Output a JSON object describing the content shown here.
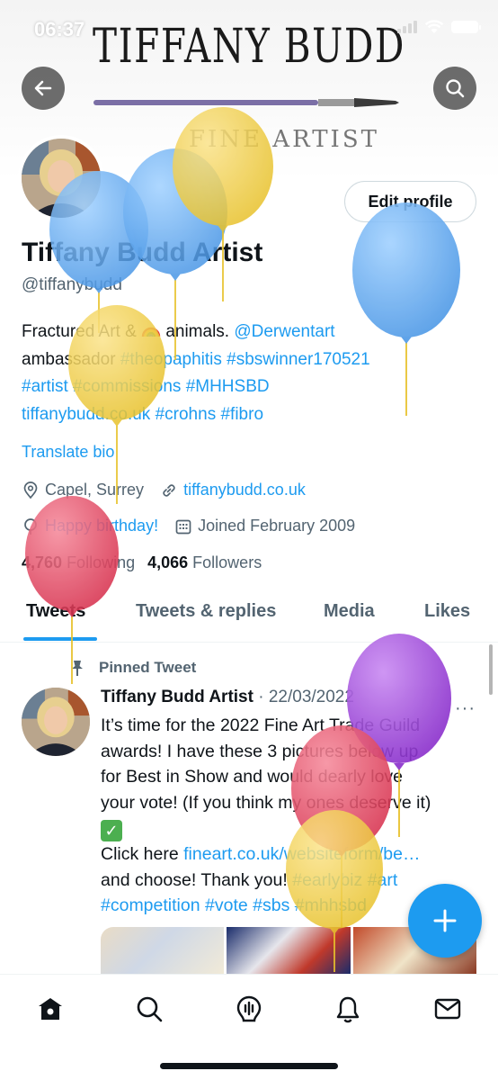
{
  "status_bar": {
    "time": "06:37"
  },
  "banner": {
    "title": "TIFFANY BUDD",
    "subtitle": "FINE ARTIST"
  },
  "header": {
    "back_icon": "arrow-left-icon",
    "search_icon": "search-icon"
  },
  "profile": {
    "edit_label": "Edit profile",
    "display_name": "Tiffany Budd Artist",
    "handle": "@tiffanybudd",
    "bio": {
      "l1_a": "Fractured Art & ",
      "l1_b": " animals. ",
      "l1_link": "@Derwentart",
      "l2_a": "ambassador ",
      "l2_link1": "#theopaphitis",
      "l2_link2": "#sbswinner170521",
      "l3_link1": "#artist",
      "l3_link2": "#commissions",
      "l3_link3": "#MHHSBD",
      "l4_link1": "tiffanybudd.co.uk",
      "l4_link2": "#crohns",
      "l4_link3": "#fibro"
    },
    "translate": "Translate bio",
    "location": "Capel, Surrey",
    "website": "tiffanybudd.co.uk",
    "birthday": "Happy birthday!",
    "joined": "Joined February 2009",
    "following_count": "4,760",
    "following_label": "Following",
    "followers_count": "4,066",
    "followers_label": "Followers"
  },
  "tabs": [
    {
      "label": "Tweets"
    },
    {
      "label": "Tweets & replies"
    },
    {
      "label": "Media"
    },
    {
      "label": "Likes"
    }
  ],
  "tweet": {
    "pinned_label": "Pinned Tweet",
    "author": "Tiffany Budd Artist",
    "date": "· 22/03/2022",
    "more": "···",
    "line1": "It’s time for the 2022 Fine Art Trade Guild",
    "line2": "awards! I have these 3 pictures below up",
    "line3": "for Best in Show and would dearly love",
    "line4": "your vote! (If you think my ones deserve it)",
    "line6_a": "Click here ",
    "line6_link": "fineart.co.uk/websiteform/be…",
    "line7_a": "and choose! Thank you! ",
    "line7_link1": "#earlybiz",
    "line7_link2": "#art",
    "line8_link1": "#competition",
    "line8_link2": "#vote",
    "line8_link3": "#sbs",
    "line8_link4": "#mhhsbd"
  },
  "nav_icons": [
    "home-icon",
    "search-icon",
    "spaces-icon",
    "notifications-icon",
    "messages-icon"
  ],
  "colors": {
    "accent": "#1d9bf0",
    "text": "#0f1419",
    "secondary": "#536471"
  },
  "balloon_colors": {
    "blue": "#5aa9f0",
    "yellow": "#f2cf3c",
    "red": "#e8455f",
    "purple": "#9a3fd6"
  }
}
